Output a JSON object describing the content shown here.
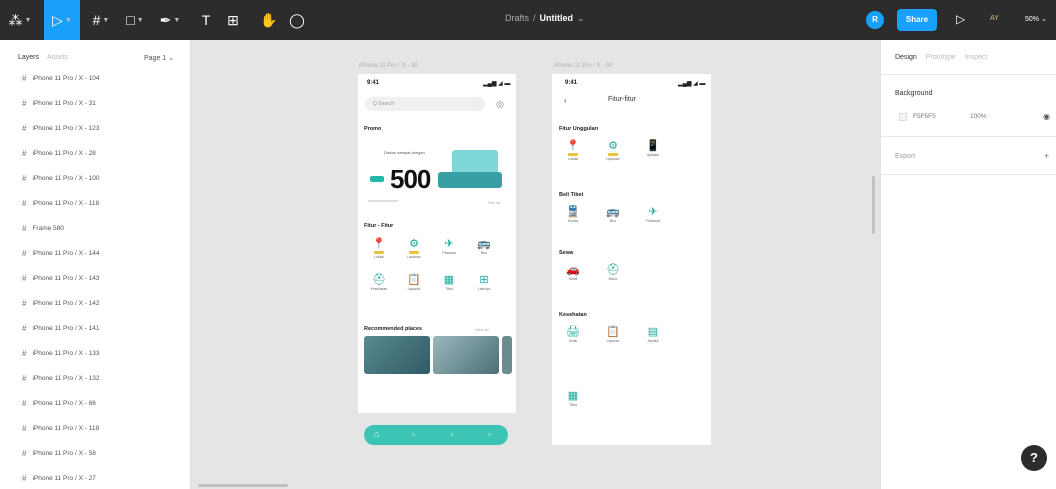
{
  "toolbar": {
    "drafts": "Drafts",
    "separator": "/",
    "file_name": "Untitled",
    "avatar_initial": "R",
    "share_label": "Share",
    "ay_label": "AY",
    "zoom_label": "50%"
  },
  "left_panel": {
    "tab_layers": "Layers",
    "tab_assets": "Assets",
    "page_selector": "Page 1",
    "layers": [
      "iPhone 11 Pro / X - 104",
      "iPhone 11 Pro / X - 31",
      "iPhone 11 Pro / X - 123",
      "iPhone 11 Pro / X - 28",
      "iPhone 11 Pro / X - 100",
      "iPhone 11 Pro / X - 118",
      "Frame 580",
      "iPhone 11 Pro / X - 144",
      "iPhone 11 Pro / X - 143",
      "iPhone 11 Pro / X - 142",
      "iPhone 11 Pro / X - 141",
      "iPhone 11 Pro / X - 133",
      "iPhone 11 Pro / X - 132",
      "iPhone 11 Pro / X - 66",
      "iPhone 11 Pro / X - 118",
      "iPhone 11 Pro / X - 58",
      "iPhone 11 Pro / X - 27"
    ]
  },
  "canvas": {
    "frame1_label": "iPhone 11 Pro / X - 30",
    "frame2_label": "iPhone 11 Pro / X - 99",
    "phone1": {
      "time": "9:41",
      "status_icons": "▂▄▆ ◢ ▬",
      "search_placeholder": "Q Search",
      "promo_section": "Promo",
      "promo_small": "Diskon sampai dengan",
      "promo_number": "500",
      "see_all": "See all",
      "fitur_title": "Fitur - Fitur",
      "icons": [
        {
          "glyph": "📍",
          "label": "Lokasi"
        },
        {
          "glyph": "⚙",
          "label": "Layanan"
        },
        {
          "glyph": "✈",
          "label": "Pesawat"
        },
        {
          "glyph": "🚌",
          "label": "Bus"
        },
        {
          "glyph": "⛑",
          "label": "Kesehatan"
        },
        {
          "glyph": "📋",
          "label": "Laporan"
        },
        {
          "glyph": "▦",
          "label": "Tiket"
        },
        {
          "glyph": "⊞",
          "label": "Lainnya"
        }
      ],
      "recommended_title": "Recommended places",
      "view_all": "View all",
      "nav": [
        "⌂",
        "▫",
        "▫",
        "▫"
      ]
    },
    "phone2": {
      "time": "9:41",
      "status_icons": "▂▄▆ ◢ ▬",
      "back": "‹",
      "title": "Fitur-fitur",
      "sections": [
        {
          "title": "Fitur Unggulan",
          "icons": [
            {
              "glyph": "📍",
              "label": "Lokasi"
            },
            {
              "glyph": "⚙",
              "label": "Layanan"
            },
            {
              "glyph": "📱",
              "label": "Aplikasi"
            }
          ]
        },
        {
          "title": "Beli Tiket",
          "icons": [
            {
              "glyph": "🚆",
              "label": "Kereta"
            },
            {
              "glyph": "🚌",
              "label": "Bus"
            },
            {
              "glyph": "✈",
              "label": "Pesawat"
            }
          ]
        },
        {
          "title": "Sewa",
          "icons": [
            {
              "glyph": "🚗",
              "label": "Mobil"
            },
            {
              "glyph": "⛑",
              "label": "Motor"
            }
          ]
        },
        {
          "title": "Kesehatan",
          "icons": [
            {
              "glyph": "🖨",
              "label": "Klinik"
            },
            {
              "glyph": "📋",
              "label": "Laporan"
            },
            {
              "glyph": "▤",
              "label": "Apotek"
            }
          ]
        },
        {
          "title": "",
          "icons": [
            {
              "glyph": "▦",
              "label": "Tiket"
            }
          ]
        }
      ]
    }
  },
  "right_panel": {
    "tab_design": "Design",
    "tab_prototype": "Prototype",
    "tab_inspect": "Inspect",
    "background_label": "Background",
    "hex": "F5F5F5",
    "opacity": "100%",
    "export_label": "Export",
    "plus": "+",
    "help": "?"
  },
  "colors": {
    "accent": "#18a0fb",
    "teal": "#1aa89b",
    "toolbar": "#2c2c2c"
  }
}
